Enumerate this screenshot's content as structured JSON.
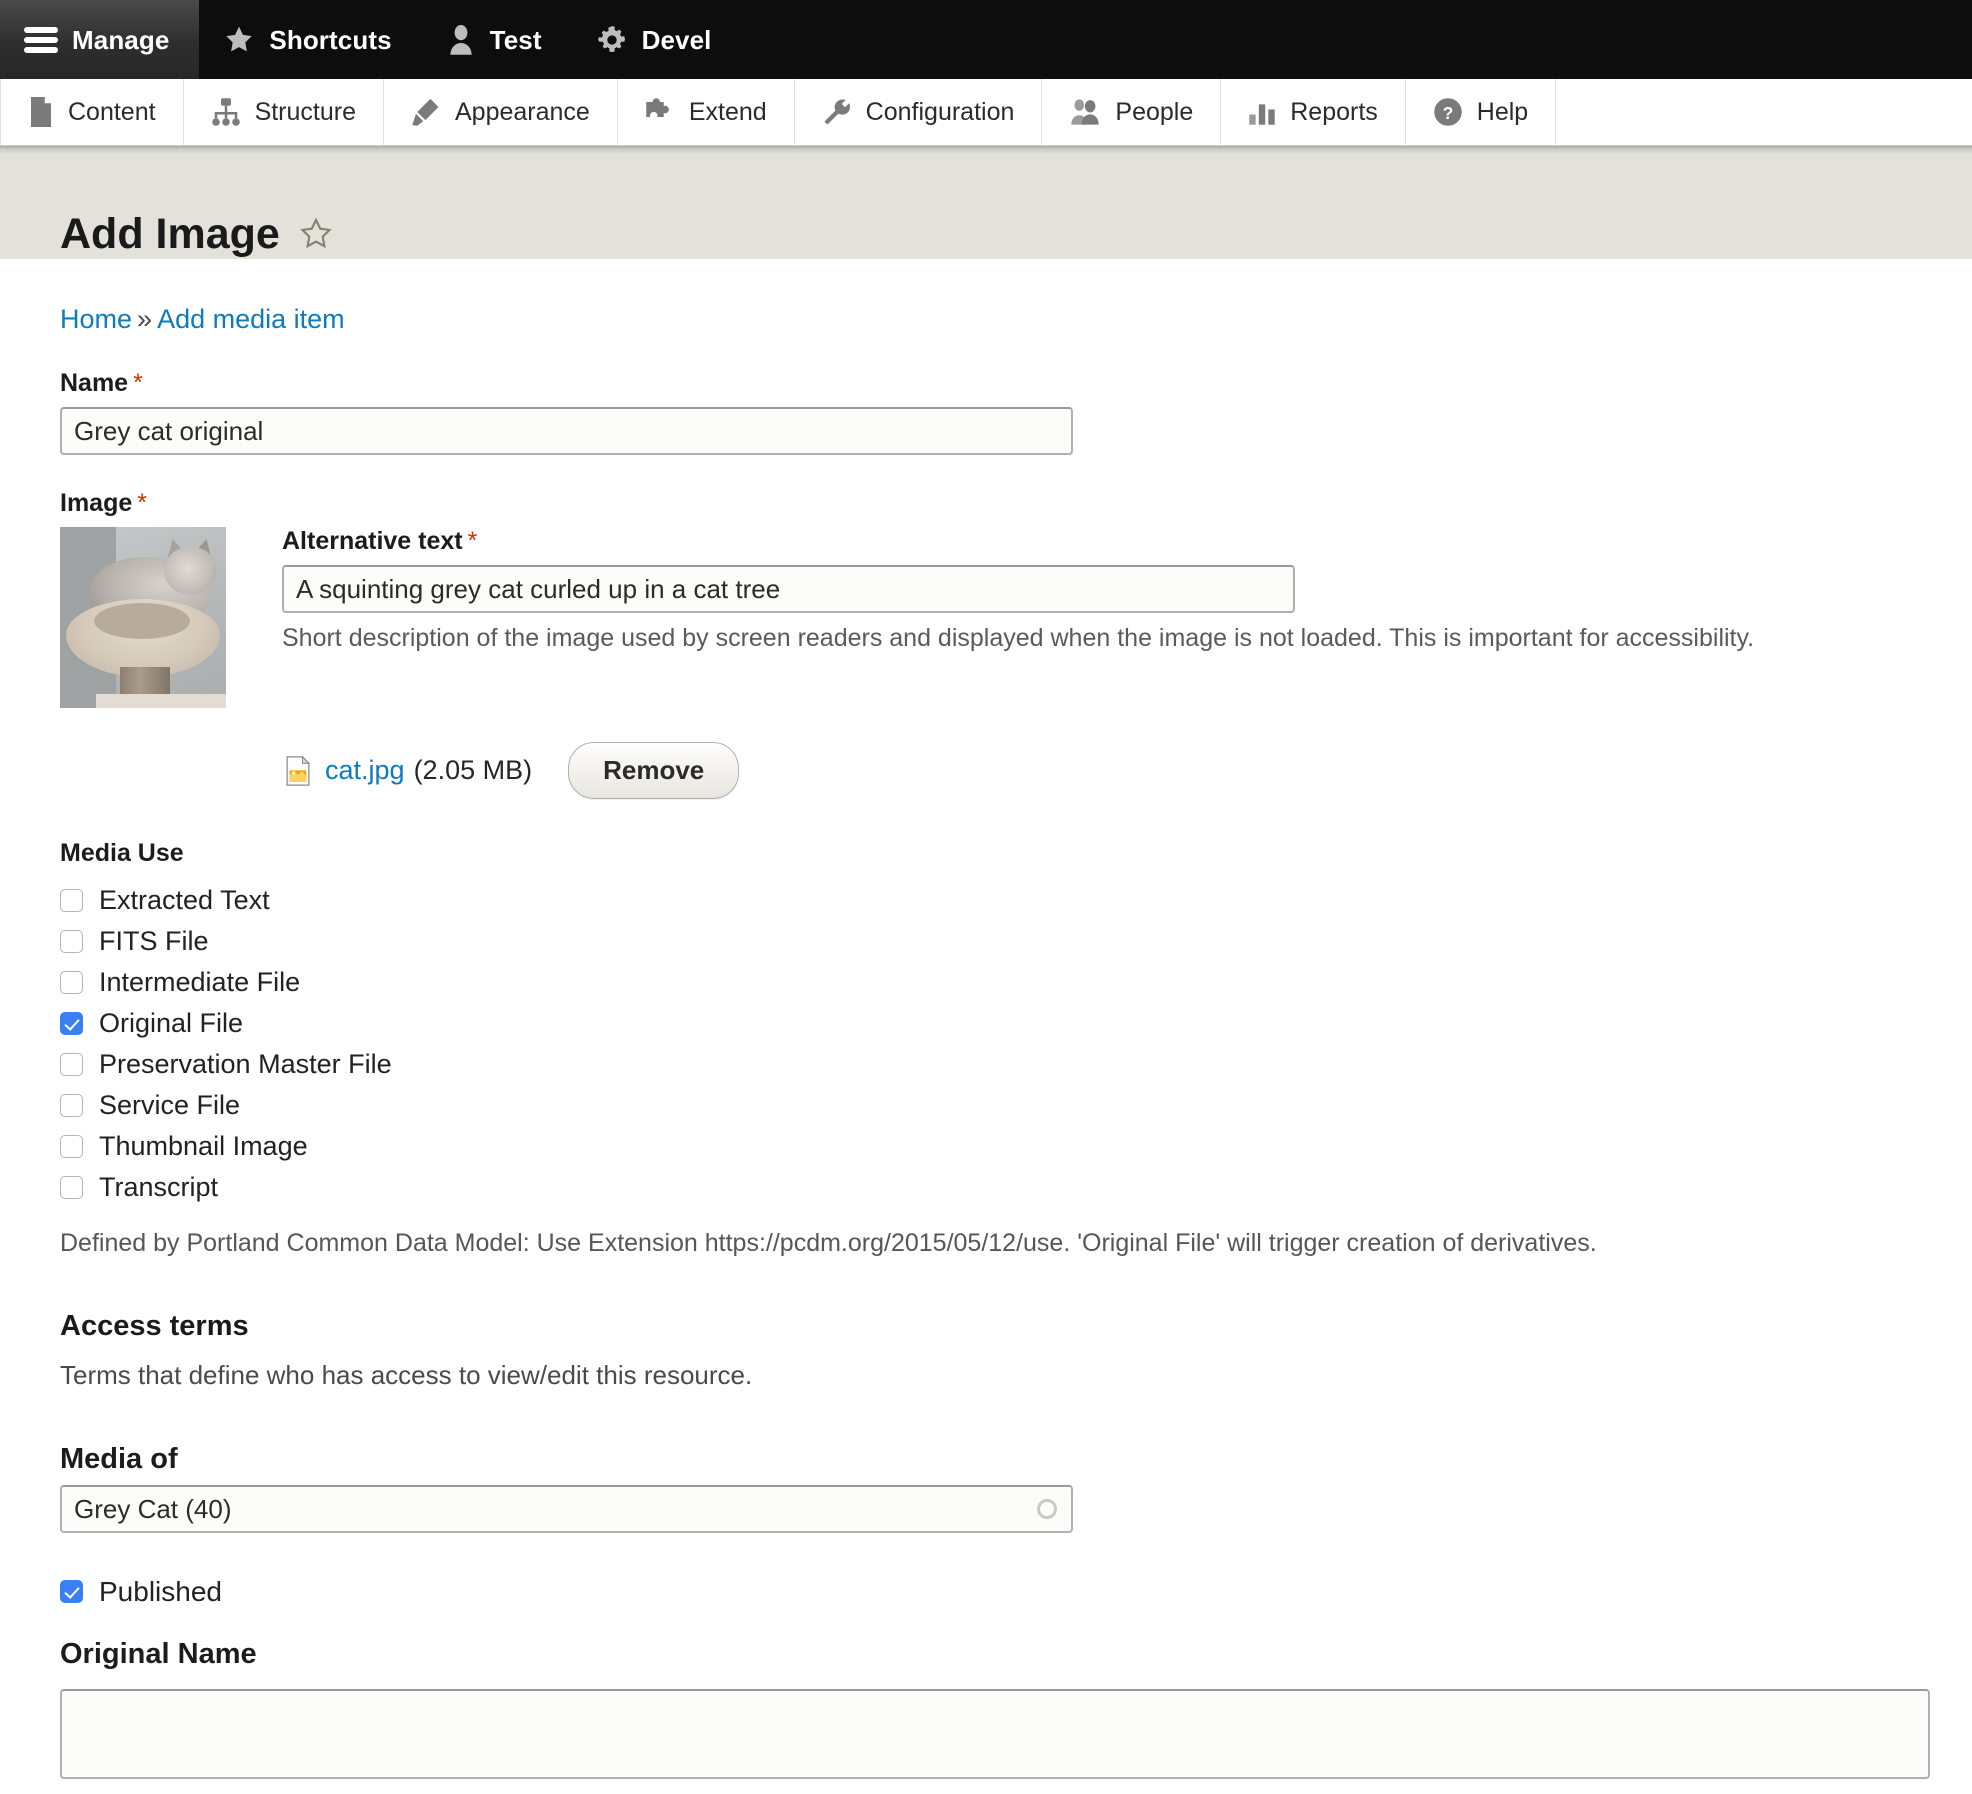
{
  "toolbar": {
    "items": [
      {
        "label": "Manage",
        "icon": "hamburger-icon",
        "active": true
      },
      {
        "label": "Shortcuts",
        "icon": "star-icon",
        "active": false
      },
      {
        "label": "Test",
        "icon": "user-icon",
        "active": false
      },
      {
        "label": "Devel",
        "icon": "gear-icon",
        "active": false
      }
    ]
  },
  "tray": {
    "items": [
      {
        "label": "Content",
        "icon": "page-icon"
      },
      {
        "label": "Structure",
        "icon": "sitemap-icon"
      },
      {
        "label": "Appearance",
        "icon": "paintbrush-icon"
      },
      {
        "label": "Extend",
        "icon": "puzzle-icon"
      },
      {
        "label": "Configuration",
        "icon": "wrench-icon"
      },
      {
        "label": "People",
        "icon": "people-icon"
      },
      {
        "label": "Reports",
        "icon": "bar-chart-icon"
      },
      {
        "label": "Help",
        "icon": "question-mark-icon"
      }
    ]
  },
  "page": {
    "title": "Add Image",
    "favorite_icon": "star-outline-icon"
  },
  "breadcrumb": {
    "home": "Home",
    "separator": "»",
    "current": "Add media item"
  },
  "name_field": {
    "label": "Name",
    "required_mark": "*",
    "value": "Grey cat original"
  },
  "image_field": {
    "label": "Image",
    "required_mark": "*",
    "thumbnail_alt": "A squinting grey cat curled up in a cat tree",
    "alt_label": "Alternative text",
    "alt_required_mark": "*",
    "alt_value": "A squinting grey cat curled up in a cat tree",
    "alt_description": "Short description of the image used by screen readers and displayed when the image is not loaded. This is important for accessibility.",
    "file_name": "cat.jpg",
    "file_size": "(2.05 MB)",
    "remove_label": "Remove"
  },
  "media_use": {
    "label": "Media Use",
    "options": [
      {
        "label": "Extracted Text",
        "checked": false
      },
      {
        "label": "FITS File",
        "checked": false
      },
      {
        "label": "Intermediate File",
        "checked": false
      },
      {
        "label": "Original File",
        "checked": true
      },
      {
        "label": "Preservation Master File",
        "checked": false
      },
      {
        "label": "Service File",
        "checked": false
      },
      {
        "label": "Thumbnail Image",
        "checked": false
      },
      {
        "label": "Transcript",
        "checked": false
      }
    ],
    "description": "Defined by Portland Common Data Model: Use Extension https://pcdm.org/2015/05/12/use. 'Original File' will trigger creation of derivatives."
  },
  "access_terms": {
    "label": "Access terms",
    "description": "Terms that define who has access to view/edit this resource."
  },
  "media_of": {
    "label": "Media of",
    "value": "Grey Cat (40)"
  },
  "published": {
    "label": "Published",
    "checked": true
  },
  "original_name": {
    "label": "Original Name",
    "value": ""
  },
  "colors": {
    "toolbar_bg": "#0d0d0d",
    "tray_bg": "#ffffff",
    "title_band_bg": "#e2e2da",
    "link": "#0c7cba",
    "required": "#e32700",
    "checkbox_checked": "#3b7ff6"
  }
}
